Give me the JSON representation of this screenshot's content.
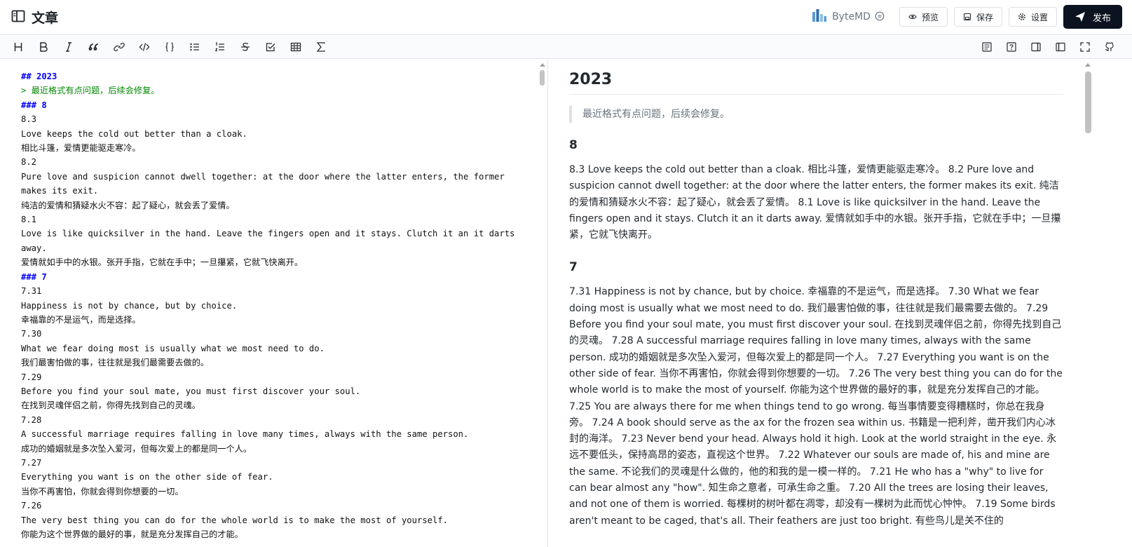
{
  "header": {
    "title": "文章",
    "brand": "ByteMD",
    "buttons": {
      "preview": "预览",
      "save": "保存",
      "settings": "设置",
      "publish": "发布"
    }
  },
  "toolbar": {
    "left_icons": [
      "heading-icon",
      "bold-icon",
      "italic-icon",
      "quote-icon",
      "link-icon",
      "code-icon",
      "code-block-icon",
      "unordered-list-icon",
      "ordered-list-icon",
      "strikethrough-icon",
      "task-list-icon",
      "table-icon",
      "math-icon"
    ],
    "right_icons": [
      "toc-icon",
      "help-icon",
      "write-only-icon",
      "preview-only-icon",
      "fullscreen-icon",
      "github-icon"
    ]
  },
  "editor": {
    "lines": [
      {
        "t": "## 2023",
        "k": "hd"
      },
      {
        "t": "> 最近格式有点问题，后续会修复。",
        "k": "qt"
      },
      {
        "t": "### 8",
        "k": "hd"
      },
      {
        "t": "8.3",
        "k": ""
      },
      {
        "t": "Love keeps the cold out better than a cloak.",
        "k": ""
      },
      {
        "t": "相比斗篷，爱情更能驱走寒冷。",
        "k": ""
      },
      {
        "t": "8.2",
        "k": ""
      },
      {
        "t": "Pure love and suspicion cannot dwell together: at the door where the latter enters, the former makes its exit.",
        "k": ""
      },
      {
        "t": "纯洁的爱情和猜疑水火不容：起了疑心，就会丢了爱情。",
        "k": ""
      },
      {
        "t": "8.1",
        "k": ""
      },
      {
        "t": "Love is like quicksilver in the hand. Leave the fingers open and it stays. Clutch it an it darts away.",
        "k": ""
      },
      {
        "t": "爱情就如手中的水银。张开手指，它就在手中；一旦攥紧，它就飞快离开。",
        "k": ""
      },
      {
        "t": "### 7",
        "k": "hd"
      },
      {
        "t": "7.31",
        "k": ""
      },
      {
        "t": "Happiness is not by chance, but by choice.",
        "k": ""
      },
      {
        "t": "幸福靠的不是运气，而是选择。",
        "k": ""
      },
      {
        "t": "7.30",
        "k": ""
      },
      {
        "t": "What we fear doing most is usually what we most need to do.",
        "k": ""
      },
      {
        "t": "我们最害怕做的事，往往就是我们最需要去做的。",
        "k": ""
      },
      {
        "t": "7.29",
        "k": ""
      },
      {
        "t": "Before you find your soul mate, you must first discover your soul.",
        "k": ""
      },
      {
        "t": "在找到灵魂伴侣之前，你得先找到自己的灵魂。",
        "k": ""
      },
      {
        "t": "7.28",
        "k": ""
      },
      {
        "t": "A successful marriage requires falling in love many times, always with the same person.",
        "k": ""
      },
      {
        "t": "成功的婚姻就是多次坠入爱河，但每次爱上的都是同一个人。",
        "k": ""
      },
      {
        "t": "7.27",
        "k": ""
      },
      {
        "t": "Everything you want is on the other side of fear.",
        "k": ""
      },
      {
        "t": "当你不再害怕，你就会得到你想要的一切。",
        "k": ""
      },
      {
        "t": "7.26",
        "k": ""
      },
      {
        "t": "The very best thing you can do for the whole world is to make the most of yourself.",
        "k": ""
      },
      {
        "t": "你能为这个世界做的最好的事，就是充分发挥自己的才能。",
        "k": ""
      }
    ]
  },
  "preview": {
    "h2": "2023",
    "quote": "最近格式有点问题，后续会修复。",
    "sec8_title": "8",
    "sec8_text": "8.3 Love keeps the cold out better than a cloak. 相比斗篷，爱情更能驱走寒冷。 8.2 Pure love and suspicion cannot dwell together: at the door where the latter enters, the former makes its exit. 纯洁的爱情和猜疑水火不容：起了疑心，就会丢了爱情。 8.1 Love is like quicksilver in the hand. Leave the fingers open and it stays. Clutch it an it darts away. 爱情就如手中的水银。张开手指，它就在手中；一旦攥紧，它就飞快离开。",
    "sec7_title": "7",
    "sec7_text": "7.31 Happiness is not by chance, but by choice. 幸福靠的不是运气，而是选择。 7.30 What we fear doing most is usually what we most need to do. 我们最害怕做的事，往往就是我们最需要去做的。 7.29 Before you find your soul mate, you must first discover your soul. 在找到灵魂伴侣之前，你得先找到自己的灵魂。 7.28 A successful marriage requires falling in love many times, always with the same person. 成功的婚姻就是多次坠入爱河，但每次爱上的都是同一个人。 7.27 Everything you want is on the other side of fear. 当你不再害怕，你就会得到你想要的一切。 7.26 The very best thing you can do for the whole world is to make the most of yourself. 你能为这个世界做的最好的事，就是充分发挥自己的才能。 7.25 You are always there for me when things tend to go wrong. 每当事情要变得糟糕时，你总在我身旁。 7.24 A book should serve as the ax for the frozen sea within us. 书籍是一把利斧，凿开我们内心冰封的海洋。 7.23 Never bend your head. Always hold it high. Look at the world straight in the eye. 永远不要低头，保持高昂的姿态，直视这个世界。 7.22 Whatever our souls are made of, his and mine are the same. 不论我们的灵魂是什么做的，他的和我的是一模一样的。 7.21 He who has a \"why\" to live for can bear almost any \"how\". 知生命之意者，可承生命之重。 7.20 All the trees are losing their leaves, and not one of them is worried. 每棵树的树叶都在凋零，却没有一棵树为此而忧心忡忡。 7.19 Some birds aren't meant to be caged, that's all. Their feathers are just too bright. 有些鸟儿是关不住的"
  }
}
